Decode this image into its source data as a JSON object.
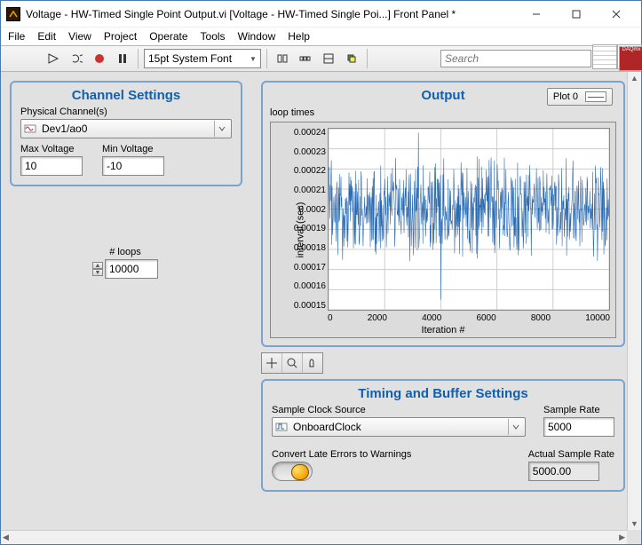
{
  "window": {
    "title": "Voltage - HW-Timed Single Point Output.vi [Voltage - HW-Timed Single Poi...] Front Panel *"
  },
  "menu": [
    "File",
    "Edit",
    "View",
    "Project",
    "Operate",
    "Tools",
    "Window",
    "Help"
  ],
  "toolbar": {
    "font": "15pt System Font",
    "search_placeholder": "Search"
  },
  "channel": {
    "title": "Channel Settings",
    "physical_label": "Physical Channel(s)",
    "physical_value": "Dev1/ao0",
    "max_label": "Max Voltage",
    "max_value": "10",
    "min_label": "Min Voltage",
    "min_value": "-10"
  },
  "loops": {
    "label": "# loops",
    "value": "10000"
  },
  "output": {
    "title": "Output",
    "legend_label": "Plot 0",
    "chart_label": "loop times",
    "ylabel": "interval (sec)",
    "xlabel": "Iteration #"
  },
  "timing": {
    "title": "Timing and Buffer Settings",
    "clock_label": "Sample Clock Source",
    "clock_value": "OnboardClock",
    "rate_label": "Sample Rate",
    "rate_value": "5000",
    "warn_label": "Convert Late Errors to Warnings",
    "actual_label": "Actual Sample Rate",
    "actual_value": "5000.00"
  },
  "chart_data": {
    "type": "line",
    "title": "loop times",
    "xlabel": "Iteration #",
    "ylabel": "interval (sec)",
    "xlim": [
      0,
      10000
    ],
    "ylim": [
      0.00015,
      0.00024
    ],
    "xticks": [
      0,
      2000,
      4000,
      6000,
      8000,
      10000
    ],
    "yticks": [
      0.00015,
      0.00016,
      0.00017,
      0.00018,
      0.00019,
      0.0002,
      0.00021,
      0.00022,
      0.00023,
      0.00024
    ],
    "series": [
      {
        "name": "Plot 0",
        "description": "noisy timing jitter centered near 0.0002 sec, range roughly 0.00016–0.00024",
        "mean": 0.0002,
        "n": 10000
      }
    ]
  }
}
